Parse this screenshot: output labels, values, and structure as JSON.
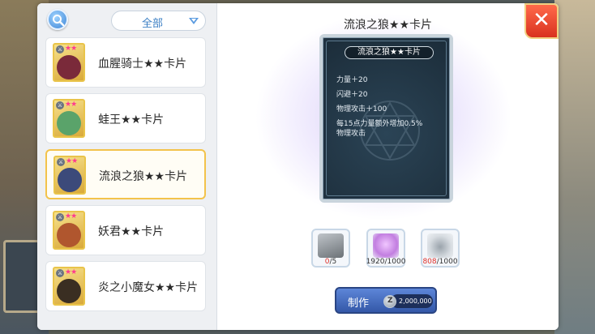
{
  "filter": {
    "selected": "全部"
  },
  "card_list": [
    {
      "name": "血腥骑士★★卡片",
      "stars": "★★",
      "art_color": "#7a2a3a",
      "selected": false
    },
    {
      "name": "蛙王★★卡片",
      "stars": "★★",
      "art_color": "#5aa36a",
      "selected": false
    },
    {
      "name": "流浪之狼★★卡片",
      "stars": "★★",
      "art_color": "#3c4a7a",
      "selected": true
    },
    {
      "name": "妖君★★卡片",
      "stars": "★★",
      "art_color": "#b0562e",
      "selected": false
    },
    {
      "name": "炎之小魔女★★卡片",
      "stars": "★★",
      "art_color": "#3a2e22",
      "selected": false
    }
  ],
  "detail": {
    "title": "流浪之狼★★卡片",
    "card": {
      "name": "流浪之狼★★卡片",
      "stats": [
        "力量＋20",
        "闪避＋20",
        "物理攻击＋100",
        "每15点力量额外增加0.5%",
        "物理攻击"
      ]
    }
  },
  "materials": [
    {
      "icon": "wolf-card-icon",
      "have": "0",
      "need": "/5",
      "sufficient": false
    },
    {
      "icon": "pink-crystal-icon",
      "text": "1920/1000",
      "sufficient": true
    },
    {
      "icon": "gray-dust-icon",
      "have": "808",
      "need": "/1000",
      "sufficient": false
    }
  ],
  "craft": {
    "label": "制作",
    "cost": "2,000,000",
    "coin_symbol": "Z"
  },
  "colors": {
    "accent": "#3b7fc4",
    "close": "#e0432c",
    "selected_border": "#f3c34b",
    "insufficient": "#e0312a"
  }
}
